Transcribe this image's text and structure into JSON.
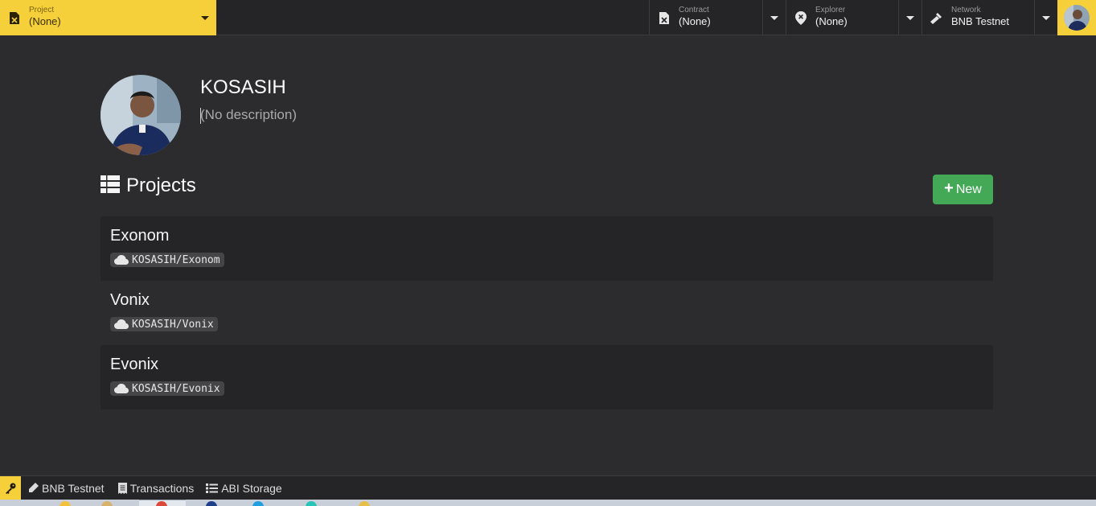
{
  "topbar": {
    "project": {
      "label": "Project",
      "value": "(None)",
      "icon": "file-x-icon"
    },
    "contract": {
      "label": "Contract",
      "value": "(None)",
      "icon": "file-x-icon"
    },
    "explorer": {
      "label": "Explorer",
      "value": "(None)",
      "icon": "map-pin-icon"
    },
    "network": {
      "label": "Network",
      "value": "BNB Testnet",
      "icon": "hammer-icon"
    },
    "avatar_icon": "avatar"
  },
  "profile": {
    "name": "KOSASIH",
    "description": "(No description)"
  },
  "projects": {
    "title": "Projects",
    "new_button": "New",
    "items": [
      {
        "name": "Exonom",
        "path": "KOSASIH/Exonom"
      },
      {
        "name": "Vonix",
        "path": "KOSASIH/Vonix"
      },
      {
        "name": "Evonix",
        "path": "KOSASIH/Evonix"
      }
    ]
  },
  "statusbar": {
    "network": "BNB Testnet",
    "transactions": "Transactions",
    "abi_storage": "ABI Storage"
  },
  "colors": {
    "accent": "#f6d03a",
    "new_button": "#43a957",
    "background": "#2c2c2e"
  }
}
